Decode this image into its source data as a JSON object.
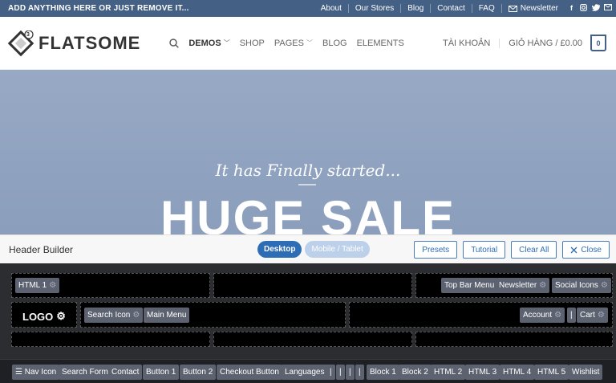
{
  "topbar": {
    "promo": "ADD ANYTHING HERE OR JUST REMOVE IT...",
    "links": [
      "About",
      "Our Stores",
      "Blog",
      "Contact",
      "FAQ"
    ],
    "newsletter": "Newsletter",
    "social_icons": [
      "facebook-icon",
      "instagram-icon",
      "twitter-icon",
      "email-icon"
    ]
  },
  "header": {
    "logo_text": "FLATSOME",
    "logo_badge": "3",
    "nav": [
      "DEMOS",
      "SHOP",
      "PAGES",
      "BLOG",
      "ELEMENTS"
    ],
    "account": "TÀI KHOẢN",
    "cart_label": "GIỎ HÀNG / £0.00",
    "cart_count": "0"
  },
  "hero": {
    "script_text": "It has Finally started...",
    "headline": "HUGE SALE"
  },
  "builder": {
    "title": "Header Builder",
    "desktop": "Desktop",
    "mobile": "Mobile / Tablet",
    "presets": "Presets",
    "tutorial": "Tutorial",
    "clear_all": "Clear All",
    "close": "Close",
    "top_left": [
      "HTML 1"
    ],
    "top_right": [
      "Top Bar Menu",
      "Newsletter",
      "Social Icons"
    ],
    "main_logo": "LOGO",
    "main_left": [
      "Search Icon",
      "Main Menu"
    ],
    "main_right": [
      "Account",
      "|",
      "Cart"
    ],
    "available": [
      "☰ Nav Icon",
      "Search Form",
      "Contact",
      "Button 1",
      "Button 2",
      "Checkout Button",
      "Languages",
      "|",
      "|",
      "|",
      "|",
      "Block 1",
      "Block 2",
      "HTML 2",
      "HTML 3",
      "HTML 4",
      "HTML 5",
      "Wishlist"
    ]
  },
  "colors": {
    "brand": "#446084",
    "accent_blue": "#2d6db5",
    "builder_bg": "#2b2d31"
  }
}
